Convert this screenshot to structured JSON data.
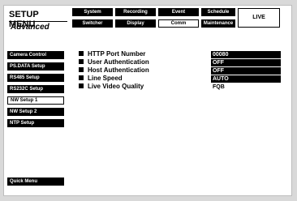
{
  "header": {
    "title": "SETUP MENU",
    "mode": "Advanced",
    "top_tabs": [
      "System",
      "Recording",
      "Event",
      "Schedule"
    ],
    "bottom_tabs": [
      "Switcher",
      "Display",
      "Comm",
      "Maintenance"
    ],
    "active_tab": "Comm",
    "live_label": "LIVE"
  },
  "sidebar": {
    "items": [
      {
        "label": "Camera Control"
      },
      {
        "label": "PS.DATA Setup"
      },
      {
        "label": "RS485 Setup"
      },
      {
        "label": "RS232C Setup"
      },
      {
        "label": "NW Setup 1"
      },
      {
        "label": "NW Setup 2"
      },
      {
        "label": "NTP Setup"
      }
    ],
    "active": "NW Setup 1",
    "quick_menu": "Quick Menu"
  },
  "settings": [
    {
      "label": "HTTP Port Number",
      "value": "00080"
    },
    {
      "label": "User Authentication",
      "value": "OFF"
    },
    {
      "label": "Host Authentication",
      "value": "OFF"
    },
    {
      "label": "Line Speed",
      "value": "AUTO"
    },
    {
      "label": "Live Video Quality",
      "value": "FQB"
    }
  ]
}
